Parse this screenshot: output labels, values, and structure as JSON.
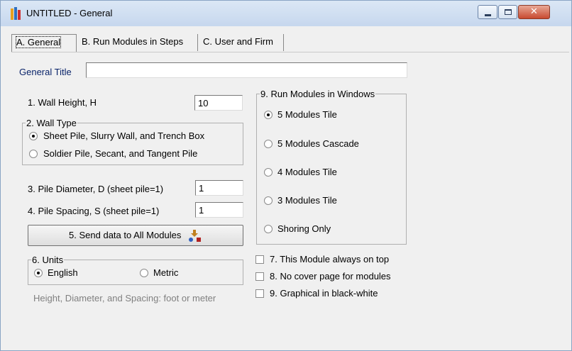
{
  "window": {
    "title": "UNTITLED - General",
    "close_glyph": "✕"
  },
  "tabs": [
    {
      "label": "A. General"
    },
    {
      "label": "B.  Run Modules in Steps"
    },
    {
      "label": "C. User and Firm"
    }
  ],
  "general_title": {
    "label": "General Title",
    "value": ""
  },
  "wall_height": {
    "label": "1. Wall Height, H",
    "value": "10"
  },
  "wall_type": {
    "legend": "2. Wall Type",
    "options": [
      "Sheet Pile, Slurry Wall, and Trench Box",
      "Soldier Pile, Secant, and Tangent Pile"
    ],
    "selected": 0
  },
  "pile_diameter": {
    "label": "3. Pile Diameter, D (sheet pile=1)",
    "value": "1"
  },
  "pile_spacing": {
    "label": "4. Pile Spacing, S  (sheet pile=1)",
    "value": "1"
  },
  "send_button": {
    "label": "5. Send data to All Modules",
    "icon": "send-data-icon"
  },
  "units": {
    "legend": "6. Units",
    "options": [
      "English",
      "Metric"
    ],
    "selected": 0,
    "note": "Height, Diameter, and Spacing: foot or meter"
  },
  "run_windows": {
    "legend": "9. Run Modules in Windows",
    "options": [
      "5 Modules Tile",
      "5 Modules Cascade",
      "4 Modules Tile",
      "3 Modules Tile",
      "Shoring Only"
    ],
    "selected": 0
  },
  "checks": [
    {
      "label": "7. This Module always on top",
      "checked": false
    },
    {
      "label": "8. No cover page for modules",
      "checked": false
    },
    {
      "label": "9. Graphical in black-white",
      "checked": false
    }
  ],
  "colors": {
    "title_bar": "#c6d7ee",
    "label_blue": "#0a246a",
    "note_grey": "#808080"
  }
}
